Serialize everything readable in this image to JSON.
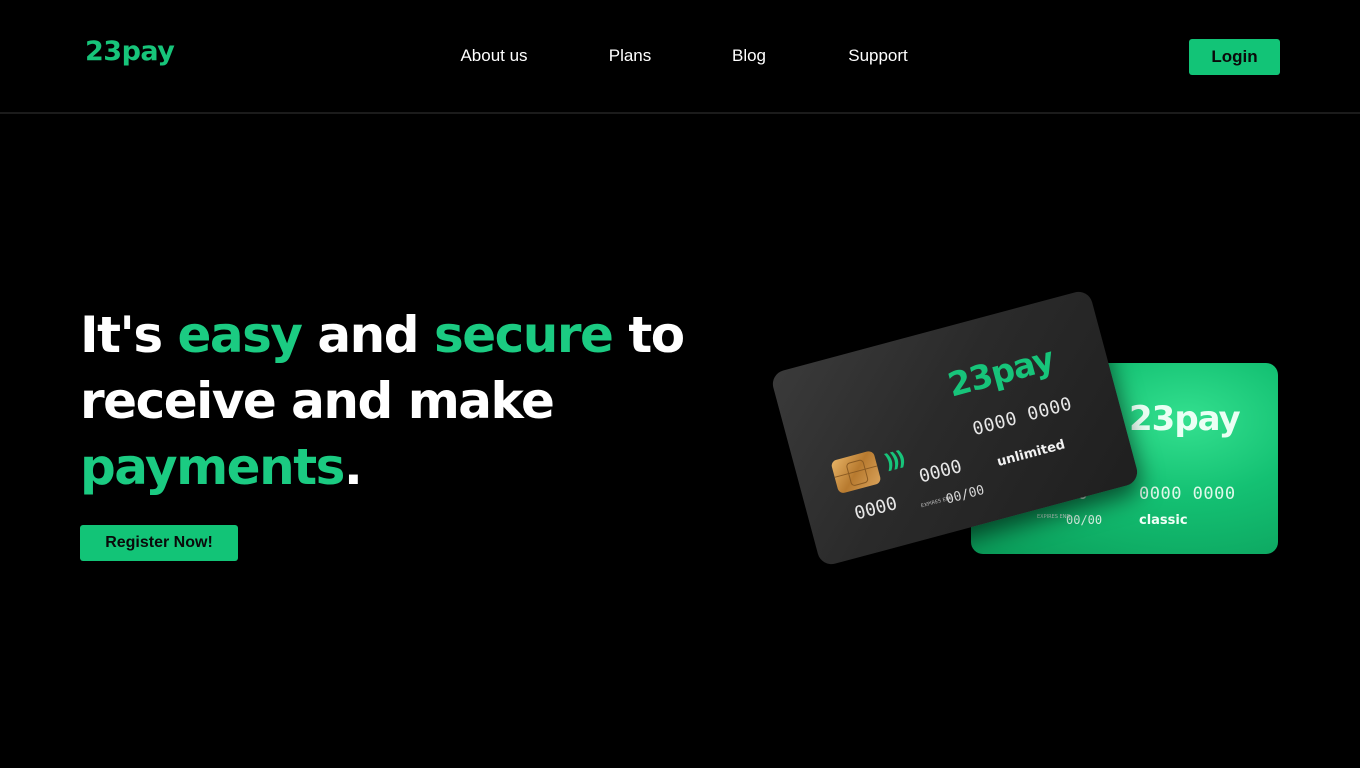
{
  "header": {
    "logo": "23pay",
    "nav": [
      "About us",
      "Plans",
      "Blog",
      "Support"
    ],
    "login_label": "Login"
  },
  "hero": {
    "title_parts": [
      "It's ",
      "easy",
      " and ",
      "secure",
      " to receive and make ",
      "payments",
      "."
    ],
    "register_label": "Register Now!"
  },
  "cards": {
    "black": {
      "logo": "23pay",
      "number_part1": "0000 0000",
      "number_part2": "0000",
      "number_part3": "0000",
      "expires_label": "EXPIRES END",
      "expiry": "00/00",
      "tier": "unlimited"
    },
    "green": {
      "logo": "23pay",
      "number_left": "000",
      "number_right": "0000 0000",
      "expires_label": "EXPIRES END",
      "expiry": "00/00",
      "tier": "classic"
    }
  },
  "colors": {
    "accent": "#17c47a",
    "background": "#000000",
    "button_text": "#0a0a0a"
  }
}
